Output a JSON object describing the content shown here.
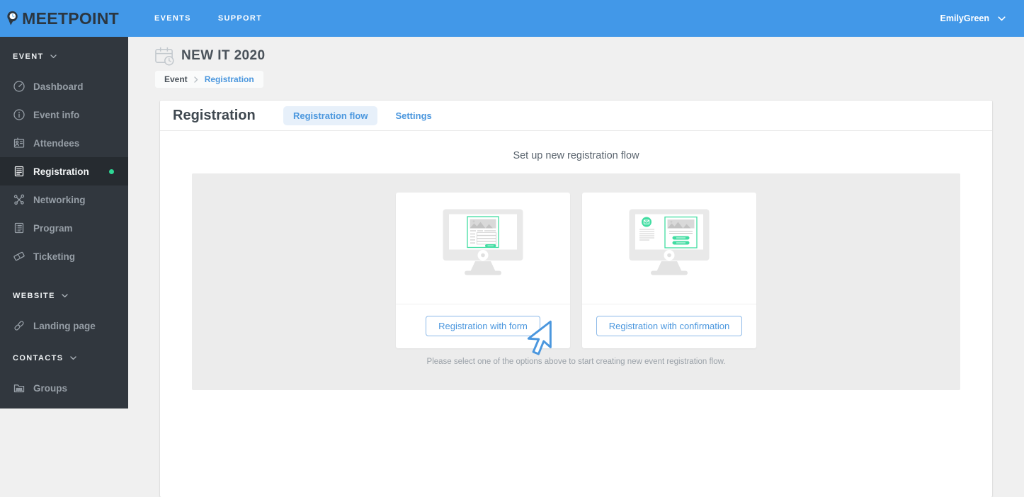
{
  "colors": {
    "topbar-blue": "#4298e8",
    "accent-blue": "#4b97de",
    "green": "#2ed795",
    "illustration-green": "#41dda2",
    "sidebar-bg": "#31373e",
    "sidebar-active-bg": "#262b30",
    "content-bg": "#f0f0f0",
    "panel-grey": "#ececec"
  },
  "topbar": {
    "brand": {
      "meet": "MEET",
      "point": "POINT",
      "icon": "meetpoint-pin-clock-logo"
    },
    "nav": [
      {
        "label": "EVENTS"
      },
      {
        "label": "SUPPORT"
      }
    ],
    "user": {
      "name": "EmilyGreen",
      "icon": "chevron-down-icon"
    }
  },
  "sidebar": {
    "sections": [
      {
        "label": "EVENT",
        "icon": "chevron-down-icon",
        "items": [
          {
            "label": "Dashboard",
            "icon": "dashboard-gauge-icon",
            "active": false
          },
          {
            "label": "Event info",
            "icon": "info-circle-icon",
            "active": false
          },
          {
            "label": "Attendees",
            "icon": "id-card-icon",
            "active": false
          },
          {
            "label": "Registration",
            "icon": "form-document-icon",
            "active": true,
            "badge_dot": true
          },
          {
            "label": "Networking",
            "icon": "network-nodes-icon",
            "active": false
          },
          {
            "label": "Program",
            "icon": "list-document-icon",
            "active": false
          },
          {
            "label": "Ticketing",
            "icon": "ticket-icon",
            "active": false
          }
        ]
      },
      {
        "label": "WEBSITE",
        "icon": "chevron-down-icon",
        "items": [
          {
            "label": "Landing page",
            "icon": "link-icon",
            "active": false
          }
        ]
      },
      {
        "label": "CONTACTS",
        "icon": "chevron-down-icon",
        "items": [
          {
            "label": "Groups",
            "icon": "folder-people-icon",
            "active": false
          }
        ]
      }
    ]
  },
  "page": {
    "event_title": "NEW IT 2020",
    "event_icon": "calendar-clock-icon",
    "breadcrumb": {
      "parent": "Event",
      "current": "Registration",
      "separator_icon": "chevron-right-icon"
    }
  },
  "registration": {
    "title": "Registration",
    "tabs": [
      {
        "label": "Registration flow",
        "active": true
      },
      {
        "label": "Settings",
        "active": false
      }
    ],
    "subtitle": "Set up new registration flow",
    "options": [
      {
        "button_label": "Registration with form",
        "illustration": "monitor-with-registration-form"
      },
      {
        "button_label": "Registration with confirmation",
        "illustration": "monitor-with-confirmation-email"
      }
    ],
    "cursor_icon": "cursor-arrow-icon",
    "helper_text": "Please select one of the options above to start creating new event registration flow."
  }
}
